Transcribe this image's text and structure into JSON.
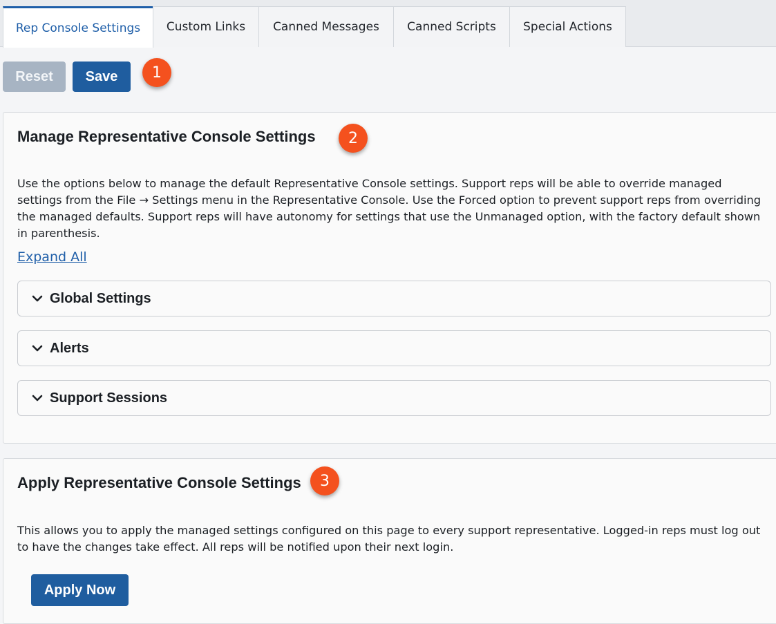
{
  "tabs": [
    {
      "label": "Rep Console Settings",
      "active": true
    },
    {
      "label": "Custom Links"
    },
    {
      "label": "Canned Messages"
    },
    {
      "label": "Canned Scripts"
    },
    {
      "label": "Special Actions"
    }
  ],
  "toolbar": {
    "reset_label": "Reset",
    "save_label": "Save",
    "step_badge": "1"
  },
  "manage": {
    "title": "Manage Representative Console Settings",
    "step_badge": "2",
    "description": "Use the options below to manage the default Representative Console settings. Support reps will be able to override managed settings from the File → Settings menu in the Representative Console. Use the Forced option to prevent support reps from overriding the managed defaults. Support reps will have autonomy for settings that use the Unmanaged option, with the factory default shown in parenthesis.",
    "expand_all": "Expand All",
    "sections": [
      {
        "label": "Global Settings"
      },
      {
        "label": "Alerts"
      },
      {
        "label": "Support Sessions"
      }
    ]
  },
  "apply": {
    "title": "Apply Representative Console Settings",
    "step_badge": "3",
    "description": "This allows you to apply the managed settings configured on this page to every support representative. Logged-in reps must log out to have the changes take effect. All reps will be notified upon their next login.",
    "button_label": "Apply Now"
  },
  "colors": {
    "primary": "#1f5d9f",
    "disabled": "#a7b4c3",
    "badge": "#f4511e"
  }
}
